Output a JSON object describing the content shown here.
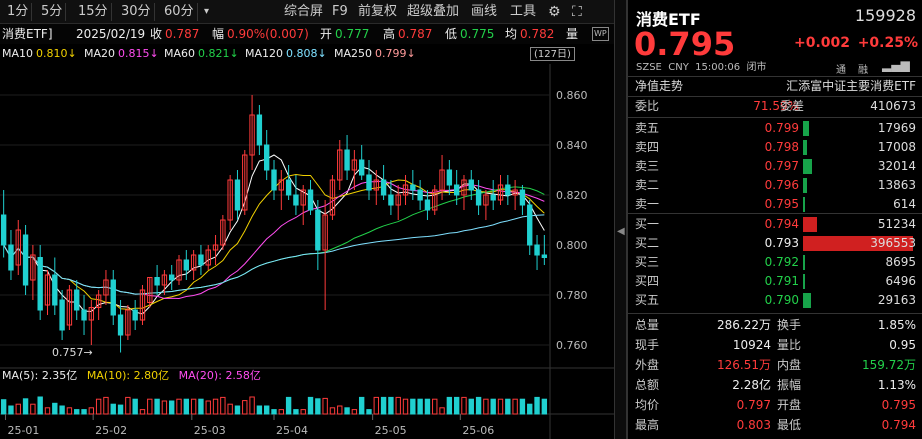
{
  "toolbar": {
    "periods": [
      "1分",
      "5分",
      "15分",
      "30分",
      "60分"
    ],
    "more": "▾",
    "tools": [
      "综合屏",
      "F9",
      "前复权",
      "超级叠加",
      "画线",
      "工具"
    ],
    "gear": "⚙",
    "fullscreen": "⛶"
  },
  "info": {
    "name": "消费ETF]",
    "date": "2025/02/19",
    "close_label": "收",
    "close": "0.787",
    "amp_label": "幅",
    "amp": "0.90%(0.007)",
    "open_label": "开",
    "open": "0.777",
    "high_label": "高",
    "high": "0.787",
    "low_label": "低",
    "low": "0.775",
    "avg_label": "均",
    "avg": "0.782",
    "vol_label": "量",
    "badge": "WP"
  },
  "ma": {
    "ma10_label": "MA10",
    "ma10": "0.810↓",
    "ma20_label": "MA20",
    "ma20": "0.815↓",
    "ma60_label": "MA60",
    "ma60": "0.821↓",
    "ma120_label": "MA120",
    "ma120": "0.808↓",
    "ma250_label": "MA250",
    "ma250": "0.799↓",
    "trend_days": "(127日)"
  },
  "volume_ma": {
    "ma5_label": "MA(5):",
    "ma5": "2.35亿",
    "ma10_label": "MA(10):",
    "ma10": "2.80亿",
    "ma20_label": "MA(20):",
    "ma20": "2.58亿"
  },
  "chart_data": {
    "type": "candlestick",
    "y_ticks": [
      "0.860",
      "0.840",
      "0.820",
      "0.800",
      "0.780",
      "0.760"
    ],
    "ylim": [
      0.754,
      0.87
    ],
    "x_ticks": [
      "25-01",
      "25-02",
      "25-03",
      "25-04",
      "25-05",
      "25-06"
    ],
    "low_marker": "0.757→",
    "candles": [
      [
        0.812,
        0.822,
        0.795,
        0.8
      ],
      [
        0.8,
        0.806,
        0.786,
        0.79
      ],
      [
        0.792,
        0.81,
        0.788,
        0.806
      ],
      [
        0.804,
        0.808,
        0.78,
        0.784
      ],
      [
        0.786,
        0.8,
        0.778,
        0.796
      ],
      [
        0.795,
        0.8,
        0.77,
        0.774
      ],
      [
        0.776,
        0.79,
        0.772,
        0.788
      ],
      [
        0.788,
        0.795,
        0.772,
        0.776
      ],
      [
        0.778,
        0.782,
        0.762,
        0.766
      ],
      [
        0.768,
        0.784,
        0.766,
        0.782
      ],
      [
        0.782,
        0.786,
        0.77,
        0.774
      ],
      [
        0.774,
        0.78,
        0.764,
        0.77
      ],
      [
        0.77,
        0.778,
        0.76,
        0.775
      ],
      [
        0.775,
        0.782,
        0.77,
        0.78
      ],
      [
        0.78,
        0.79,
        0.776,
        0.786
      ],
      [
        0.786,
        0.79,
        0.768,
        0.772
      ],
      [
        0.772,
        0.778,
        0.757,
        0.764
      ],
      [
        0.764,
        0.776,
        0.762,
        0.774
      ],
      [
        0.774,
        0.778,
        0.766,
        0.77
      ],
      [
        0.77,
        0.784,
        0.768,
        0.782
      ],
      [
        0.777,
        0.787,
        0.775,
        0.787
      ],
      [
        0.787,
        0.792,
        0.78,
        0.784
      ],
      [
        0.784,
        0.79,
        0.78,
        0.788
      ],
      [
        0.788,
        0.792,
        0.782,
        0.786
      ],
      [
        0.786,
        0.796,
        0.784,
        0.794
      ],
      [
        0.794,
        0.798,
        0.786,
        0.79
      ],
      [
        0.79,
        0.798,
        0.786,
        0.796
      ],
      [
        0.796,
        0.8,
        0.788,
        0.792
      ],
      [
        0.792,
        0.8,
        0.79,
        0.798
      ],
      [
        0.798,
        0.804,
        0.792,
        0.8
      ],
      [
        0.8,
        0.812,
        0.798,
        0.81
      ],
      [
        0.81,
        0.828,
        0.806,
        0.826
      ],
      [
        0.826,
        0.83,
        0.81,
        0.814
      ],
      [
        0.814,
        0.838,
        0.812,
        0.836
      ],
      [
        0.836,
        0.86,
        0.83,
        0.852
      ],
      [
        0.852,
        0.856,
        0.836,
        0.84
      ],
      [
        0.84,
        0.846,
        0.826,
        0.83
      ],
      [
        0.83,
        0.834,
        0.818,
        0.822
      ],
      [
        0.822,
        0.83,
        0.814,
        0.826
      ],
      [
        0.826,
        0.832,
        0.818,
        0.82
      ],
      [
        0.82,
        0.828,
        0.812,
        0.816
      ],
      [
        0.816,
        0.824,
        0.808,
        0.822
      ],
      [
        0.822,
        0.826,
        0.812,
        0.814
      ],
      [
        0.814,
        0.818,
        0.79,
        0.798
      ],
      [
        0.798,
        0.818,
        0.774,
        0.812
      ],
      [
        0.812,
        0.828,
        0.81,
        0.826
      ],
      [
        0.826,
        0.842,
        0.822,
        0.838
      ],
      [
        0.838,
        0.844,
        0.826,
        0.83
      ],
      [
        0.83,
        0.838,
        0.822,
        0.834
      ],
      [
        0.834,
        0.84,
        0.826,
        0.828
      ],
      [
        0.828,
        0.834,
        0.818,
        0.822
      ],
      [
        0.822,
        0.83,
        0.816,
        0.826
      ],
      [
        0.826,
        0.832,
        0.818,
        0.82
      ],
      [
        0.82,
        0.826,
        0.812,
        0.816
      ],
      [
        0.816,
        0.824,
        0.81,
        0.82
      ],
      [
        0.82,
        0.828,
        0.816,
        0.824
      ],
      [
        0.824,
        0.83,
        0.818,
        0.822
      ],
      [
        0.822,
        0.826,
        0.814,
        0.818
      ],
      [
        0.818,
        0.822,
        0.81,
        0.814
      ],
      [
        0.814,
        0.824,
        0.812,
        0.822
      ],
      [
        0.822,
        0.836,
        0.818,
        0.83
      ],
      [
        0.83,
        0.834,
        0.82,
        0.824
      ],
      [
        0.824,
        0.83,
        0.816,
        0.82
      ],
      [
        0.82,
        0.828,
        0.814,
        0.826
      ],
      [
        0.826,
        0.83,
        0.818,
        0.822
      ],
      [
        0.822,
        0.826,
        0.812,
        0.816
      ],
      [
        0.816,
        0.822,
        0.81,
        0.82
      ],
      [
        0.82,
        0.826,
        0.814,
        0.818
      ],
      [
        0.818,
        0.828,
        0.816,
        0.824
      ],
      [
        0.824,
        0.828,
        0.816,
        0.82
      ],
      [
        0.82,
        0.826,
        0.814,
        0.822
      ],
      [
        0.822,
        0.824,
        0.812,
        0.816
      ],
      [
        0.816,
        0.818,
        0.796,
        0.8
      ],
      [
        0.8,
        0.804,
        0.79,
        0.796
      ],
      [
        0.796,
        0.804,
        0.792,
        0.795
      ]
    ]
  },
  "quote": {
    "name": "消费ETF",
    "code": "159928",
    "price": "0.795",
    "change": "+0.002",
    "change_pct": "+0.25%",
    "market": "SZSE",
    "currency": "CNY",
    "time": "15:00:06",
    "status": "闭市",
    "tag1": "通",
    "tag2": "融",
    "nav_label": "净值走势",
    "fund_name": "汇添富中证主要消费ETF"
  },
  "orderbook": {
    "ratio_label": "委比",
    "ratio": "71.59%",
    "diff_label": "委差",
    "diff": "410673",
    "asks": [
      {
        "label": "卖五",
        "price": "0.799",
        "vol": "17969",
        "fill": 0.05
      },
      {
        "label": "卖四",
        "price": "0.798",
        "vol": "17008",
        "fill": 0.04
      },
      {
        "label": "卖三",
        "price": "0.797",
        "vol": "32014",
        "fill": 0.08
      },
      {
        "label": "卖二",
        "price": "0.796",
        "vol": "13863",
        "fill": 0.035
      },
      {
        "label": "卖一",
        "price": "0.795",
        "vol": "614",
        "fill": 0.01
      }
    ],
    "bids": [
      {
        "label": "买一",
        "price": "0.794",
        "vol": "51234",
        "fill": 0.13,
        "color": "#d02020"
      },
      {
        "label": "买二",
        "price": "0.793",
        "vol": "396553",
        "fill": 1.0,
        "color": "#d02020"
      },
      {
        "label": "买三",
        "price": "0.792",
        "vol": "8695",
        "fill": 0.02,
        "color": "#17a34a"
      },
      {
        "label": "买四",
        "price": "0.791",
        "vol": "6496",
        "fill": 0.015,
        "color": "#17a34a"
      },
      {
        "label": "买五",
        "price": "0.790",
        "vol": "29163",
        "fill": 0.07,
        "color": "#17a34a"
      }
    ]
  },
  "stats": [
    {
      "l1": "总量",
      "v1": "286.22万",
      "c1": "white",
      "l2": "换手",
      "v2": "1.85%",
      "c2": "white"
    },
    {
      "l1": "现手",
      "v1": "10924",
      "c1": "white",
      "l2": "量比",
      "v2": "0.95",
      "c2": "white"
    },
    {
      "l1": "外盘",
      "v1": "126.51万",
      "c1": "red",
      "l2": "内盘",
      "v2": "159.72万",
      "c2": "green"
    },
    {
      "l1": "总额",
      "v1": "2.28亿",
      "c1": "white",
      "l2": "振幅",
      "v2": "1.13%",
      "c2": "white"
    },
    {
      "l1": "均价",
      "v1": "0.797",
      "c1": "red",
      "l2": "开盘",
      "v2": "0.795",
      "c2": "red"
    },
    {
      "l1": "最高",
      "v1": "0.803",
      "c1": "red",
      "l2": "最低",
      "v2": "0.794",
      "c2": "red"
    }
  ]
}
